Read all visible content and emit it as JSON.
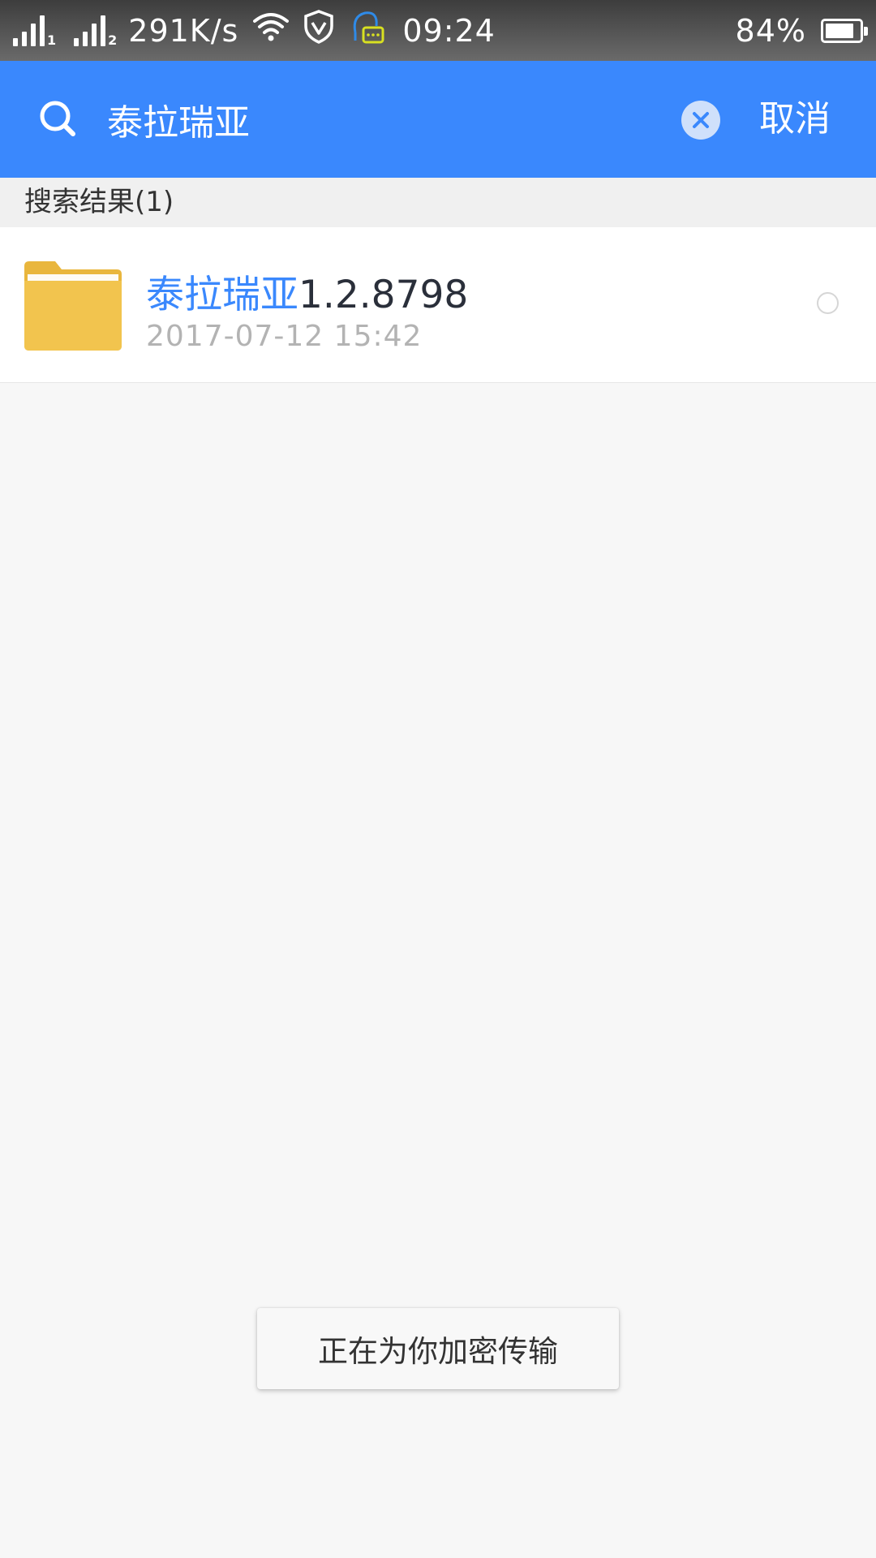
{
  "status_bar": {
    "sim1": "1",
    "sim2": "2",
    "net_speed": "291K/s",
    "time": "09:24",
    "battery_percent": "84%",
    "battery_level": 0.84,
    "icons": [
      "signal-icon",
      "wifi-icon",
      "shield-icon",
      "message-icon",
      "battery-icon"
    ]
  },
  "search": {
    "query": "泰拉瑞亚",
    "cancel_label": "取消"
  },
  "results": {
    "header": "搜索结果(1)",
    "items": [
      {
        "name_highlight": "泰拉瑞亚",
        "name_rest": "1.2.8798",
        "date": "2017-07-12  15:42",
        "icon": "folder-icon"
      }
    ]
  },
  "toast": {
    "message": "正在为你加密传输"
  },
  "colors": {
    "accent": "#3a88fd",
    "folder": "#f2c44e",
    "date_gray": "#b3b3b3"
  }
}
